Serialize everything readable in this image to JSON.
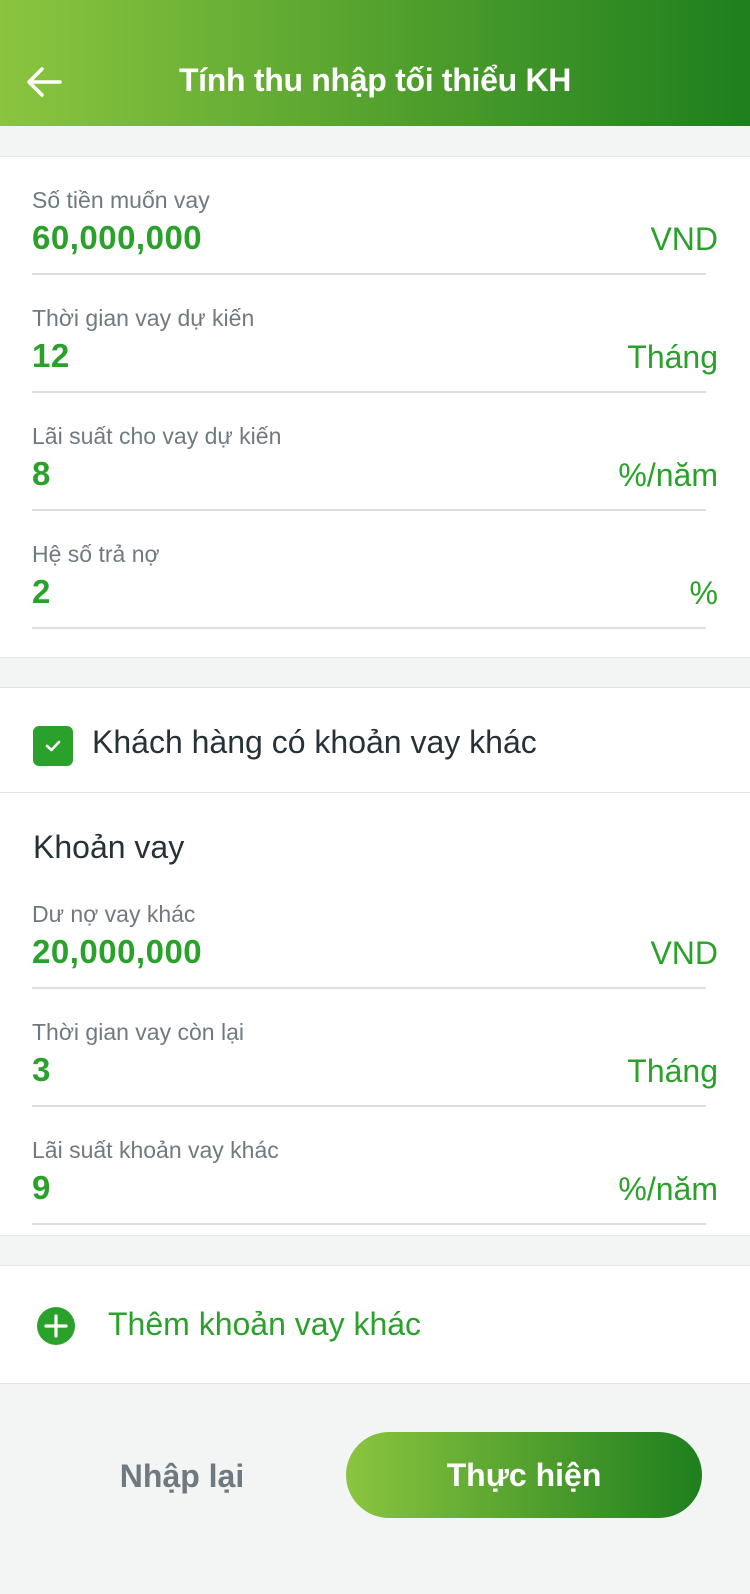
{
  "header": {
    "title": "Tính thu nhập tối thiểu KH",
    "back_icon": "arrow-left-icon"
  },
  "main_form": {
    "fields": [
      {
        "label": "Số tiền muốn vay",
        "value": "60,000,000",
        "unit": "VND"
      },
      {
        "label": "Thời gian vay dự kiến",
        "value": "12",
        "unit": "Tháng"
      },
      {
        "label": "Lãi suất cho vay dự kiến",
        "value": "8",
        "unit": "%/năm"
      },
      {
        "label": "Hệ số trả nợ",
        "value": "2",
        "unit": "%"
      }
    ]
  },
  "other_loan": {
    "checkbox_label": "Khách hàng có khoản vay khác",
    "checked": true,
    "section_title": "Khoản vay",
    "fields": [
      {
        "label": "Dư nợ vay khác",
        "value": "20,000,000",
        "unit": "VND"
      },
      {
        "label": "Thời gian vay còn lại",
        "value": "3",
        "unit": "Tháng"
      },
      {
        "label": "Lãi suất khoản vay khác",
        "value": "9",
        "unit": "%/năm"
      }
    ]
  },
  "add_loan": {
    "label": "Thêm khoản vay khác",
    "icon": "plus-circle-icon"
  },
  "actions": {
    "reset_label": "Nhập lại",
    "submit_label": "Thực hiện"
  },
  "colors": {
    "accent": "#2aa12a",
    "gradient_start": "#8bc53f",
    "gradient_end": "#1e7f1e"
  }
}
